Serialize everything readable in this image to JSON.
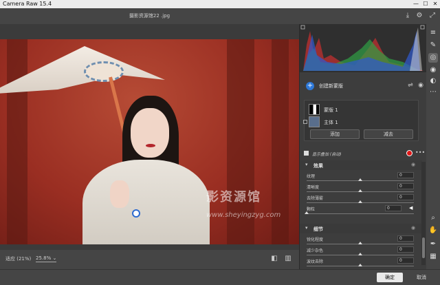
{
  "window": {
    "title": "Camera Raw 15.4",
    "controls": [
      "—",
      "☐",
      "✕"
    ]
  },
  "topbar": {
    "filename": "摄影资源馆22 .jpg",
    "icons": [
      "download-icon",
      "gear-icon",
      "expand-icon"
    ]
  },
  "bottombar": {
    "fit_label": "适应 (21%)",
    "zoom_value": "25.8%",
    "zoom_chevron": "⌄",
    "icons": [
      "frame-icon",
      "compare-view-icon"
    ]
  },
  "photo": {
    "watermark": "影资源馆",
    "watermark_url": "www.sheyingzyg.com"
  },
  "masks": {
    "create_label": "创建新蒙版",
    "items": [
      {
        "label": "蒙版 1"
      },
      {
        "label": "主体 1"
      }
    ],
    "add_label": "添加",
    "subtract_label": "减去",
    "overlay_label": "显示叠加 (自动)",
    "overlay_color": "#e01717"
  },
  "effects": {
    "title": "效果",
    "sliders": [
      {
        "label": "纹理",
        "value": "0",
        "position": 0.5
      },
      {
        "label": "清晰度",
        "value": "0",
        "position": 0.5
      },
      {
        "label": "去除薄雾",
        "value": "0",
        "position": 0.5
      },
      {
        "label": "颗粒",
        "value": "0",
        "position": 0.0
      }
    ]
  },
  "details": {
    "title": "细节",
    "sliders": [
      {
        "label": "锐化程度",
        "value": "0",
        "position": 0.5
      },
      {
        "label": "减少杂色",
        "value": "0",
        "position": 0.5
      },
      {
        "label": "波纹去除",
        "value": "0",
        "position": 0.5
      }
    ]
  },
  "footer": {
    "ok_label": "确定",
    "cancel_label": "取消"
  },
  "toolstrip": [
    "sliders-icon",
    "brush-icon",
    "mask-circle-icon",
    "redeye-icon",
    "preset-icon",
    "more-icon",
    "zoom-icon",
    "hand-icon",
    "eyedropper-icon",
    "grid-icon"
  ]
}
